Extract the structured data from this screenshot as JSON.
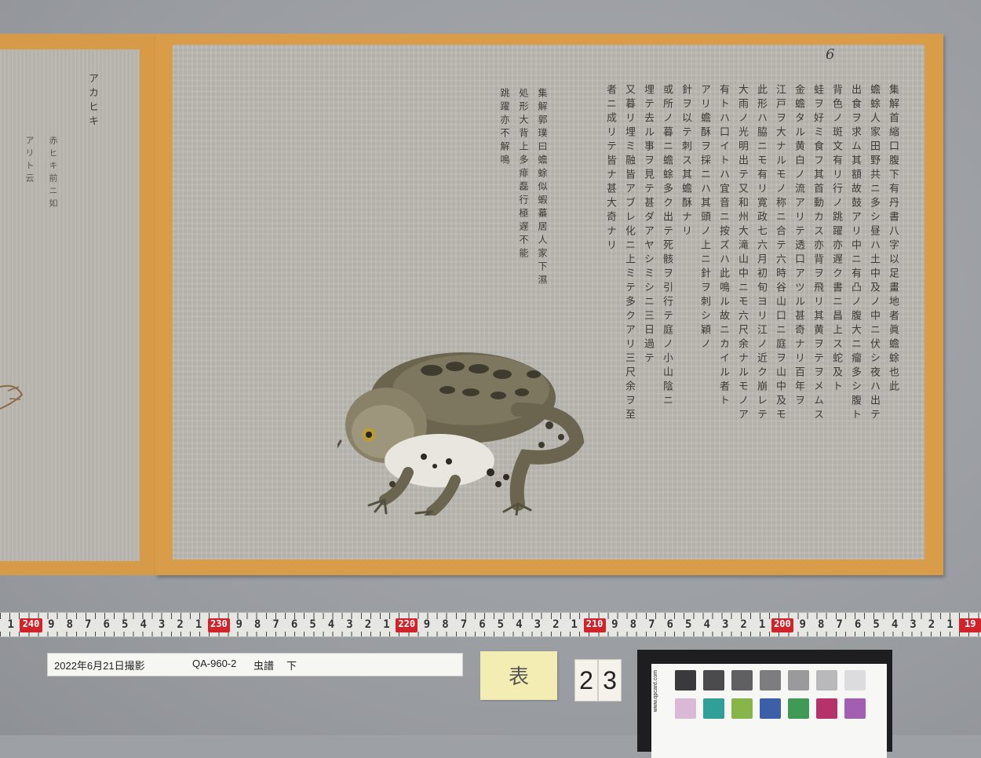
{
  "scroll": {
    "left_panel": {
      "title": "アカヒキ",
      "col2": "赤ヒキ前ニ如",
      "col3": "アリト云"
    },
    "main_panel": {
      "folio_mark": "6",
      "right_columns": [
        "集解首縮口腹下有丹書八字以足畫地者眞蟾蜍也此",
        "蟾蜍人家田野共ニ多シ昼ハ土中及ノ中ニ伏シ夜ハ出テ",
        "出食ヲ求ム其額故鼓アリ中ニ有凸ノ腹大ニ瘤多シ腹ト",
        "背色ノ斑文有リ行ノ跳躍亦遅ク書ニ昌上ス蛇及ト",
        "蛙ヲ好ミ食フ其首動カス亦背ヲ飛リ其黄ヲテヲメムス",
        "金蟾タル黄白ノ流アリテ透口アツル甚奇ナリ百年ヲ",
        "江戸ヲ大ナルモノ称ニ合テ六時谷山口ニ庭ヲ山中及モ",
        "此形ハ脇ニモ有リ寛政七六月初旬ヨリ江ノ近ク崩レテ",
        "大雨ノ光明出テ又和州大滝山中ニモ六尺余ナルモノア",
        "有トハ口イトハ宜音ニ按ズハ此鳴ル故ニカイル者ト",
        "アリ蟾酥ヲ採ニハ其頭ノ上ニ針ヲ刺シ穎ノ",
        "針ヲ以テ刺ス其蟾酥ナリ",
        "或所ノ暮ニ蟾蜍多ク出テ死骸ヲ引行テ庭ノ小山陰ニ",
        "埋テ去ル事ヲ見テ甚ダアヤシミシニ三日過テ",
        "又暮リ埋ミ融皆アブレ化ニ上ミテ多クアリ三尺余ヲ至",
        "者ニ成リテ皆ナ甚大奇ナリ"
      ],
      "middle_columns": [
        "集解郭璞曰蟾蜍似蝦蟇居人家下濕",
        "処形大背上多痱磊行極遅不能",
        "跳躍亦不解鳴"
      ]
    }
  },
  "ruler": {
    "digits": [
      "1",
      "240",
      "9",
      "8",
      "7",
      "6",
      "5",
      "4",
      "3",
      "2",
      "1",
      "230",
      "9",
      "8",
      "7",
      "6",
      "5",
      "4",
      "3",
      "2",
      "1",
      "220",
      "9",
      "8",
      "7",
      "6",
      "5",
      "4",
      "3",
      "2",
      "1",
      "210",
      "9",
      "8",
      "7",
      "6",
      "5",
      "4",
      "3",
      "2",
      "1",
      "200",
      "9",
      "8",
      "7",
      "6",
      "5",
      "4",
      "3",
      "2",
      "1",
      "19"
    ]
  },
  "label": {
    "date": "2022年6月21日撮影",
    "code": "QA-960-2",
    "title": "虫譜",
    "volume": "下"
  },
  "sticky_note": "表",
  "number_cards": [
    "2",
    "3"
  ],
  "color_card": {
    "url_text": "www.qpcard.com",
    "swatches_row1": [
      "#3a3a3c",
      "#4b4b4d",
      "#606062",
      "#7d7d7f",
      "#9a9a9c",
      "#b9b9bb",
      "#dcdcde"
    ],
    "swatches_row2": [
      "#d9b9d6",
      "#2f9f98",
      "#86b54a",
      "#3d5ea8",
      "#3f9a55",
      "#b6326a",
      "#a25fb2"
    ]
  }
}
